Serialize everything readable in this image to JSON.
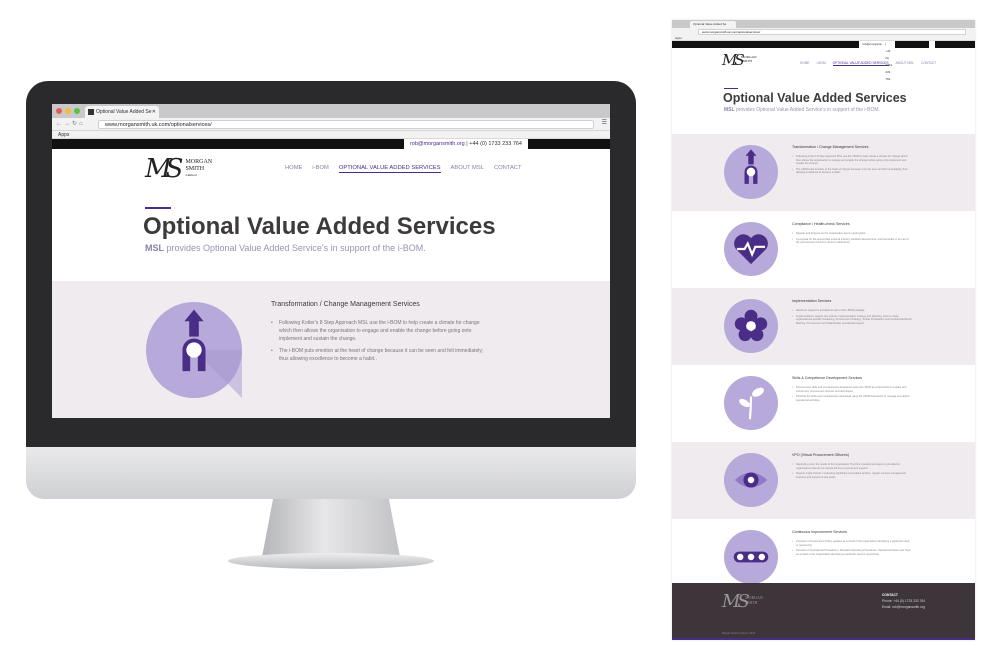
{
  "browser": {
    "tab_title": "Optional Value Added Se",
    "url": "www.morgansmith.uk.com/optionalservices/",
    "bookmarks_label": "Apps"
  },
  "site": {
    "contact_email": "rob@morgansmith.org",
    "contact_phone": "| +44 (0) 1733 233 764",
    "logo_mark": "MS",
    "logo_line1": "MORGAN",
    "logo_line2": "SMITH",
    "logo_line3": "Limited",
    "nav": [
      "HOME",
      "i-BOM",
      "OPTIONAL VALUE ADDED SERVICES",
      "ABOUT MSL",
      "CONTACT"
    ],
    "page_title": "Optional Value Added Services",
    "subtitle_bold": "MSL",
    "subtitle_rest": " provides Optional Value Added Service's in support of the i-BOM.",
    "first_service": {
      "title": "Transformation / Change Management Services",
      "bullets": [
        "Following Kotter's 8 Step Approach MSL use the i-BOM to help create a climate for change which then allows the organisation to engage and enable the change before going onto implement and sustain the change.",
        "The i-BOM puts emotion at the heart of change because it can be seen and felt immediately; thus allowing excellence to become a habit.."
      ]
    }
  },
  "right_page": {
    "services": [
      {
        "title": "Transformation / Change Management Services",
        "icon": "arrow-up-icon",
        "bullets": [
          "Following Kotter's 8 Step Approach MSL use the i-BOM to help create a climate for change which then allows the organisation to engage and enable the change before going onto implement and sustain the change.",
          "The i-BOM puts emotion at the heart of change because it can be seen and felt immediately; thus allowing excellence to become a habit.."
        ]
      },
      {
        "title": "Compliance / Health-check Services",
        "icon": "heart-pulse-icon",
        "bullets": [
          "Regular and frequent as the organisation deems appropriate.",
          "A proposal for the appropriate external industry standard assessments, internal audits or as part of the procurement function's drive for adherence."
        ]
      },
      {
        "title": "Implementation Services",
        "icon": "flower-icon",
        "bullets": [
          "Hands-on support is provided as part of the i-BOM package.",
          "Implementation support can include: Implementation strategy and planning, how to create organisational specific Sustaining, Procurement Strategy, Tender Preparation and Confidential Bench Marking, Procurement and Stakeholder operational support."
        ]
      },
      {
        "title": "Skills & Competence Development Services",
        "icon": "sprout-icon",
        "bullets": [
          "Procurement skills and competencies developed using the i-BOM as a framework to explain and instruct key procurement theories and techniques.",
          "Prioritise the skills and competencies developed using the i-BOM framework to manage and deliver operational activities."
        ]
      },
      {
        "title": "VPO (Virtual Procurement Officer/s)",
        "icon": "eye-icon",
        "bullets": [
          "Depending upon the needs of the organisation 'front line' operational support is provided to organisations that do not require full time procurement support.",
          "Support might include: conducting significant competitive tenders, regular contract management sessions and support at site policy."
        ]
      },
      {
        "title": "Continuous Improvement Services",
        "icon": "dots-icon",
        "bullets": [
          "Provision of Governance Policy updates as a result of the organisation identifying a particular need or opportunity.",
          "Provision of Operational Procedures / Standard Operating Procedures, Operational Notes and Tools as a result of the organisation identifying a particular need or opportunity."
        ]
      }
    ],
    "footer": {
      "contact_heading": "CONTACT",
      "phone": "Phone: +44 (0) 1733 233 764",
      "email": "Email: rob@morgansmith.org",
      "copyright": "Morgan Smith Limited © 2014"
    }
  },
  "colors": {
    "accent": "#4a2d86",
    "icon_light": "#b7a9d9",
    "icon_mid": "#8f7bc4",
    "band": "#f0ebee"
  }
}
